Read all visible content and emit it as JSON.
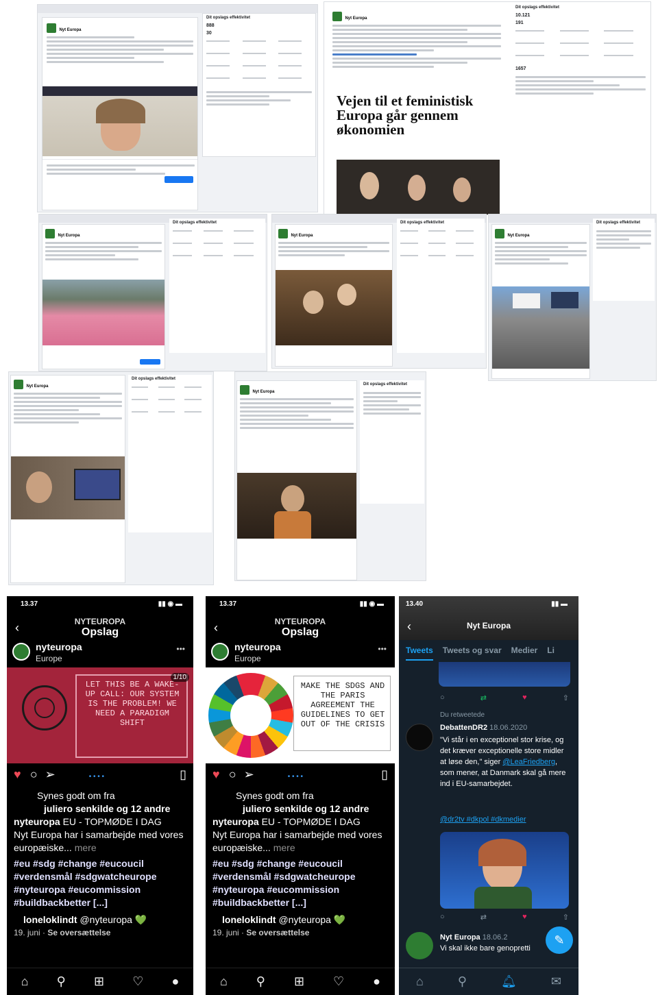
{
  "fb_post_1": {
    "page_name": "Nyt Europa",
    "reach_title": "Dit opslags effektivitet",
    "reach_value": "888",
    "engagement_value": "30"
  },
  "fb_post_2": {
    "page_name": "Nyt Europa",
    "headline": "Vejen til et feministisk Europa går gennem økonomien",
    "reach_title": "Dit opslags effektivitet",
    "reach_value": "10.121",
    "engagement_value": "191",
    "clicks_value": "1657"
  },
  "fb_post_3": {
    "page_name": "Nyt Europa",
    "reach_title": "Dit opslags effektivitet"
  },
  "fb_post_4": {
    "page_name": "Nyt Europa",
    "reach_title": "Dit opslags effektivitet"
  },
  "fb_post_5": {
    "page_name": "Nyt Europa",
    "reach_title": "Dit opslags effektivitet"
  },
  "fb_post_6": {
    "page_name": "Nyt Europa",
    "reach_title": "Dit opslags effektivitet"
  },
  "fb_post_7": {
    "page_name": "Nyt Europa",
    "reach_title": "Dit opslags effektivitet"
  },
  "ig_1": {
    "time": "13.37",
    "account_header": "NYTEUROPA",
    "screen_title": "Opslag",
    "username": "nyteuropa",
    "location": "Europe",
    "counter": "1/10",
    "quote": "LET THIS BE A WAKE-UP CALL: OUR SYSTEM IS THE PROBLEM! WE NEED A PARADIGM SHIFT",
    "likes_prefix": "Synes godt om fra",
    "likes_user": "juliero senkilde og 12 andre",
    "caption_user": "nyteuropa",
    "caption": "EU - TOPMØDE I DAG",
    "caption_2": "Nyt Europa har i samarbejde med vores europæiske...",
    "more": "mere",
    "hashtags": "#eu #sdg #change #eucoucil #verdensmål #sdgwatcheurope #nyteuropa #eucommission #buildbackbetter [...]",
    "comment_user": "loneloklindt",
    "comment": "@nyteuropa 💚",
    "date": "19. juni",
    "translate": "Se oversættelse"
  },
  "ig_2": {
    "time": "13.37",
    "account_header": "NYTEUROPA",
    "screen_title": "Opslag",
    "username": "nyteuropa",
    "location": "Europe",
    "quote": "MAKE THE SDGS AND THE PARIS AGREEMENT THE GUIDELINES TO GET OUT OF THE CRISIS",
    "likes_prefix": "Synes godt om fra",
    "likes_user": "juliero senkilde og 12 andre",
    "caption_user": "nyteuropa",
    "caption": "EU - TOPMØDE I DAG",
    "caption_2": "Nyt Europa har i samarbejde med vores europæiske...",
    "more": "mere",
    "hashtags": "#eu #sdg #change #eucoucil #verdensmål #sdgwatcheurope #nyteuropa #eucommission #buildbackbetter [...]",
    "comment_user": "loneloklindt",
    "comment": "@nyteuropa 💚",
    "date": "19. juni",
    "translate": "Se oversættelse"
  },
  "twitter": {
    "time": "13.40",
    "profile_name": "Nyt Europa",
    "tabs": [
      "Tweets",
      "Tweets og svar",
      "Medier",
      "Li"
    ],
    "retweeted_label": "Du retweetede",
    "author": "DebattenDR2",
    "date": "18.06.2020",
    "tweet": "\"Vi står i en exceptionel stor krise, og det kræver exceptionelle store midler at løse den,\" siger",
    "mention": "@LeaFriedberg",
    "tweet_end": ", som mener, at Danmark skal gå mere ind i EU-samarbejdet.",
    "hashtags": "@dr2tv #dkpol #dkmedier",
    "next_author": "Nyt Europa",
    "next_date": "18.06.2",
    "next_text": "Vi skal ikke bare genopretti"
  }
}
